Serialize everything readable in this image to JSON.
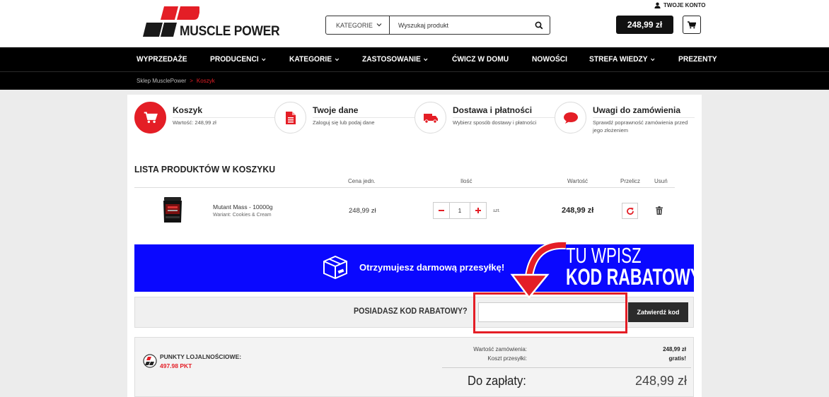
{
  "header": {
    "logo_text": "MUSCLE POWER",
    "search": {
      "category_label": "KATEGORIE",
      "placeholder": "Wyszukaj produkt"
    },
    "account_label": "TWOJE KONTO",
    "cart_total": "248,99 zł"
  },
  "nav": {
    "items": [
      {
        "label": "WYPRZEDAŻE",
        "dropdown": false
      },
      {
        "label": "PRODUCENCI",
        "dropdown": true
      },
      {
        "label": "KATEGORIE",
        "dropdown": true
      },
      {
        "label": "ZASTOSOWANIE",
        "dropdown": true
      },
      {
        "label": "ĆWICZ W DOMU",
        "dropdown": false
      },
      {
        "label": "NOWOŚCI",
        "dropdown": false
      },
      {
        "label": "STREFA WIEDZY",
        "dropdown": true
      },
      {
        "label": "PREZENTY",
        "dropdown": false
      }
    ]
  },
  "breadcrumb": {
    "root": "Sklep MusclePower",
    "separator": ">",
    "current": "Koszyk"
  },
  "steps": [
    {
      "title": "Koszyk",
      "desc": "Wartość: 248,99 zł",
      "icon": "cart-icon",
      "active": true
    },
    {
      "title": "Twoje dane",
      "desc": "Zaloguj się lub podaj dane",
      "icon": "document-icon",
      "active": false
    },
    {
      "title": "Dostawa i płatności",
      "desc": "Wybierz sposób dostawy i płatności",
      "icon": "truck-icon",
      "active": false
    },
    {
      "title": "Uwagi do zamówienia",
      "desc": "Sprawdź poprawność zamówienia przed jego złożeniem",
      "icon": "speech-bubble-icon",
      "active": false
    }
  ],
  "cart": {
    "title": "LISTA PRODUKTÓW W KOSZYKU",
    "columns": {
      "price": "Cena jedn.",
      "qty": "Ilość",
      "total": "Wartość",
      "recalc": "Przelicz",
      "remove": "Usuń"
    },
    "item": {
      "name": "Mutant Mass - 10000g",
      "variant": "Wariant: Cookies & Cream",
      "unit_price": "248,99 zł",
      "quantity": "1",
      "unit": "szt.",
      "total": "248,99 zł"
    }
  },
  "banner": {
    "text": "Otrzymujesz darmową przesyłkę!",
    "annotation_line1": "TU WPISZ",
    "annotation_line2": "KOD RABATOWY"
  },
  "coupon": {
    "label": "POSIADASZ KOD RABATOWY?",
    "value": "",
    "button": "Zatwierdź kod"
  },
  "summary": {
    "loyalty_label": "PUNKTY LOJALNOŚCIOWE:",
    "loyalty_value": "497.98 PKT",
    "order_value_label": "Wartość zamówienia:",
    "order_value": "248,99 zł",
    "shipping_label": "Koszt przesyłki:",
    "shipping_value": "gratis!",
    "to_pay_label": "Do zapłaty:",
    "to_pay_value": "248,99 zł"
  },
  "colors": {
    "accent": "#e41e26",
    "banner": "#0a08ff",
    "nav_bg": "#000000"
  }
}
